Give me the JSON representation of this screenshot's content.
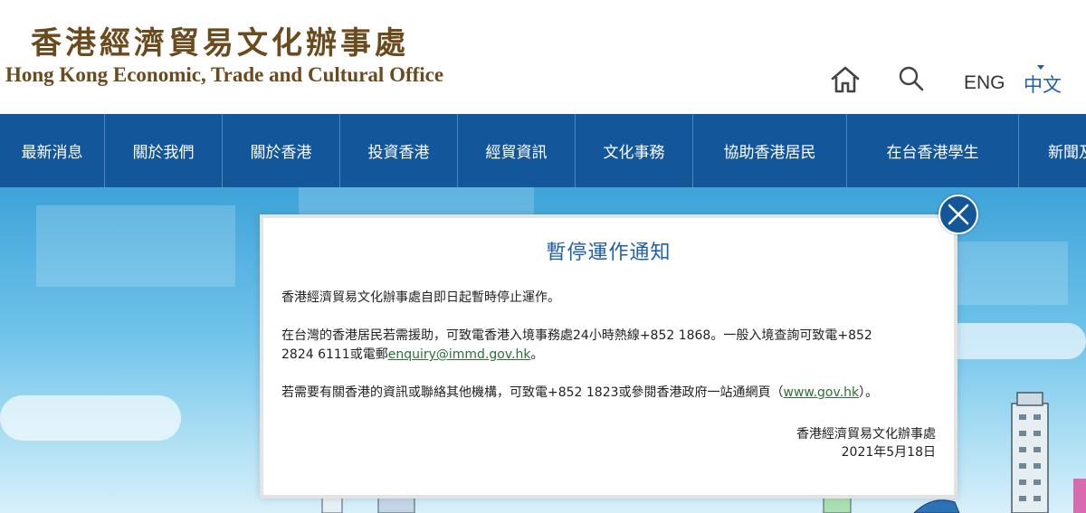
{
  "header": {
    "logo_zh": "香港經濟貿易文化辦事處",
    "logo_en": "Hong Kong Economic, Trade and Cultural Office",
    "lang_eng": "ENG",
    "lang_zh": "中文"
  },
  "nav": {
    "items": [
      "最新消息",
      "關於我們",
      "關於香港",
      "投資香港",
      "經貿資訊",
      "文化事務",
      "協助香港居民",
      "在台香港學生",
      "新聞及"
    ]
  },
  "modal": {
    "title": "暫停運作通知",
    "p1": "香港經濟貿易文化辦事處自即日起暫時停止運作。",
    "p2_line1": "在台灣的香港居民若需援助，可致電香港入境事務處24小時熱線+852 1868。一般入境查詢可致電+852",
    "p2_line2_prefix": "2824 6111或電郵",
    "p2_email": "enquiry@immd.gov.hk",
    "p2_line2_suffix": "。",
    "p3_prefix": "若需要有關香港的資訊或聯絡其他機構，可致電+852 1823或參閱香港政府一站通網頁（",
    "p3_link": "www.gov.hk",
    "p3_suffix": "）。",
    "signature_org": "香港經濟貿易文化辦事處",
    "signature_date": "2021年5月18日"
  },
  "colors": {
    "nav_bg": "#14569a",
    "title_blue": "#1e5fa8",
    "logo_brown": "#6b4a1e",
    "link_green": "#2c6f35"
  },
  "icons": [
    "home-icon",
    "search-icon",
    "close-icon"
  ]
}
